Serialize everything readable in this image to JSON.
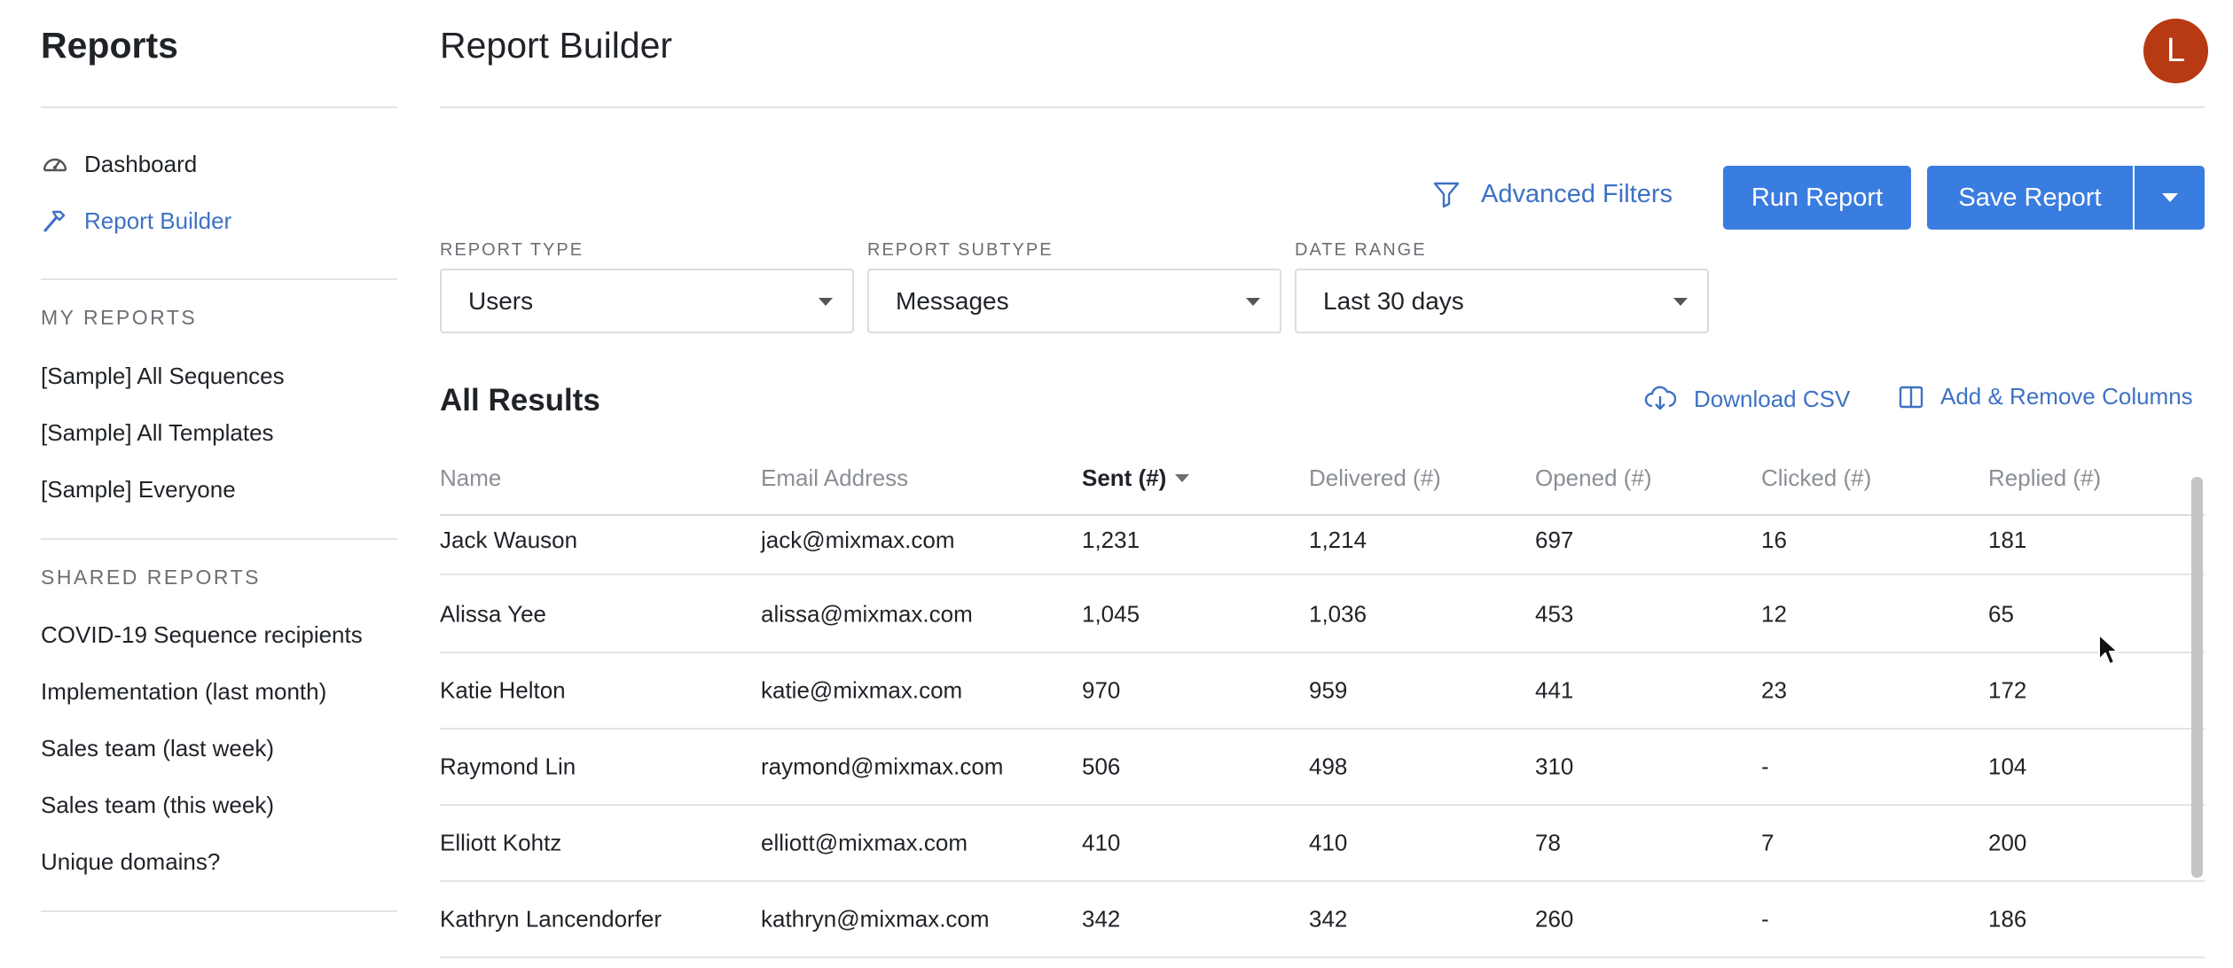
{
  "sidebar": {
    "title": "Reports",
    "nav": [
      {
        "label": "Dashboard",
        "icon": "speedometer-icon"
      },
      {
        "label": "Report Builder",
        "icon": "hammer-icon"
      }
    ],
    "my_reports_heading": "MY REPORTS",
    "my_reports": [
      "[Sample] All Sequences",
      "[Sample] All Templates",
      "[Sample] Everyone"
    ],
    "shared_reports_heading": "SHARED REPORTS",
    "shared_reports": [
      "COVID-19 Sequence recipients",
      "Implementation (last month)",
      "Sales team (last week)",
      "Sales team (this week)",
      "Unique domains?"
    ]
  },
  "header": {
    "title": "Report Builder",
    "avatar_initial": "L"
  },
  "toolbar": {
    "advanced_filters": "Advanced Filters",
    "run_report": "Run Report",
    "save_report": "Save Report"
  },
  "filters": {
    "report_type": {
      "label": "REPORT TYPE",
      "value": "Users"
    },
    "report_subtype": {
      "label": "REPORT SUBTYPE",
      "value": "Messages"
    },
    "date_range": {
      "label": "DATE RANGE",
      "value": "Last 30 days"
    }
  },
  "results": {
    "title": "All Results",
    "download_csv": "Download CSV",
    "add_remove_columns": "Add & Remove Columns",
    "columns": [
      "Name",
      "Email Address",
      "Sent (#)",
      "Delivered (#)",
      "Opened (#)",
      "Clicked (#)",
      "Replied (#)"
    ],
    "sorted_column": "Sent (#)",
    "rows": [
      [
        "Jack Wauson",
        "jack@mixmax.com",
        "1,231",
        "1,214",
        "697",
        "16",
        "181"
      ],
      [
        "Alissa Yee",
        "alissa@mixmax.com",
        "1,045",
        "1,036",
        "453",
        "12",
        "65"
      ],
      [
        "Katie Helton",
        "katie@mixmax.com",
        "970",
        "959",
        "441",
        "23",
        "172"
      ],
      [
        "Raymond Lin",
        "raymond@mixmax.com",
        "506",
        "498",
        "310",
        "-",
        "104"
      ],
      [
        "Elliott Kohtz",
        "elliott@mixmax.com",
        "410",
        "410",
        "78",
        "7",
        "200"
      ],
      [
        "Kathryn Lancendorfer",
        "kathryn@mixmax.com",
        "342",
        "342",
        "260",
        "-",
        "186"
      ]
    ]
  },
  "colors": {
    "accent": "#3a7de0",
    "link": "#3d72c4",
    "avatar": "#b83a12"
  }
}
